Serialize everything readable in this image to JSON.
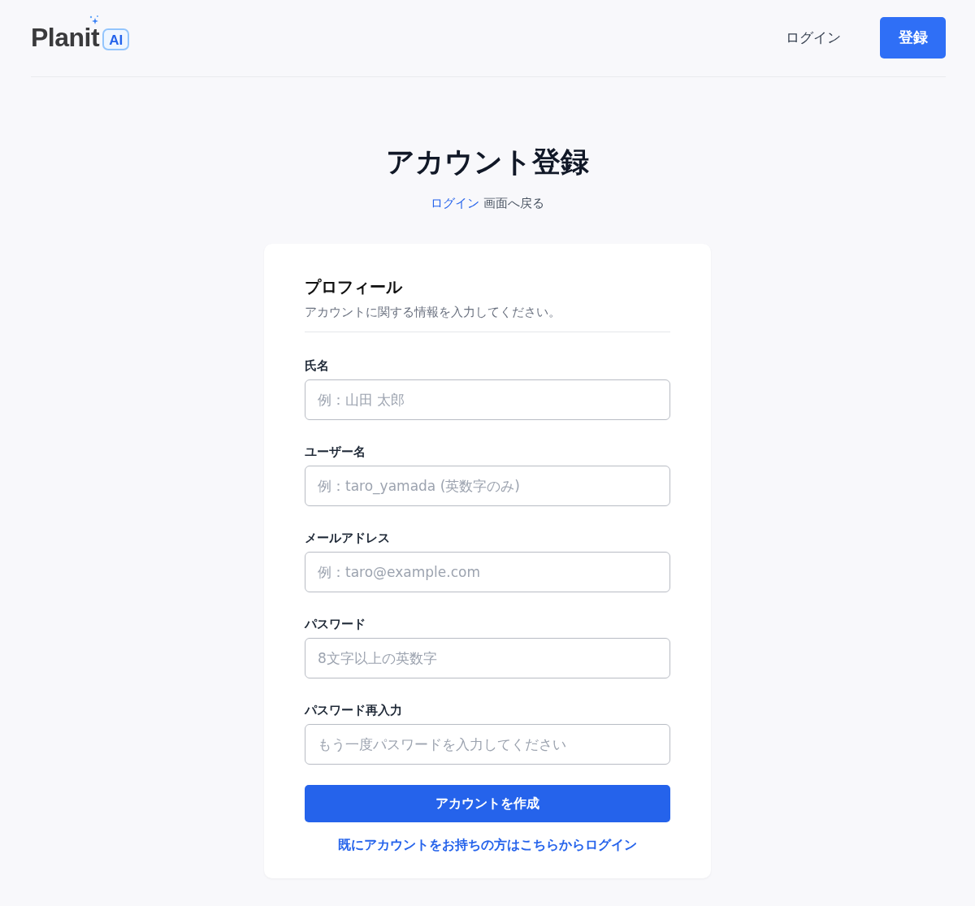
{
  "header": {
    "logo": {
      "text": "Planit",
      "badge": "AI"
    },
    "nav": [
      {
        "kind": "link",
        "label": "ログイン"
      },
      {
        "kind": "button",
        "label": "登録"
      }
    ]
  },
  "title": "アカウント登録",
  "back": {
    "link": "ログイン",
    "text": "画面へ戻る"
  },
  "card": {
    "heading": "プロフィール",
    "description": "アカウントに関する情報を入力してください。",
    "fields": [
      {
        "label": "氏名",
        "placeholder": "例：山田 太郎"
      },
      {
        "label": "ユーザー名",
        "placeholder": "例：taro_yamada (英数字のみ)"
      },
      {
        "label": "メールアドレス",
        "placeholder": "例：taro@example.com"
      },
      {
        "label": "パスワード",
        "placeholder": "8文字以上の英数字"
      },
      {
        "label": "パスワード再入力",
        "placeholder": "もう一度パスワードを入力してください"
      }
    ],
    "submit": "アカウントを作成",
    "login_link": "既にアカウントをお持ちの方はこちらからログイン"
  }
}
